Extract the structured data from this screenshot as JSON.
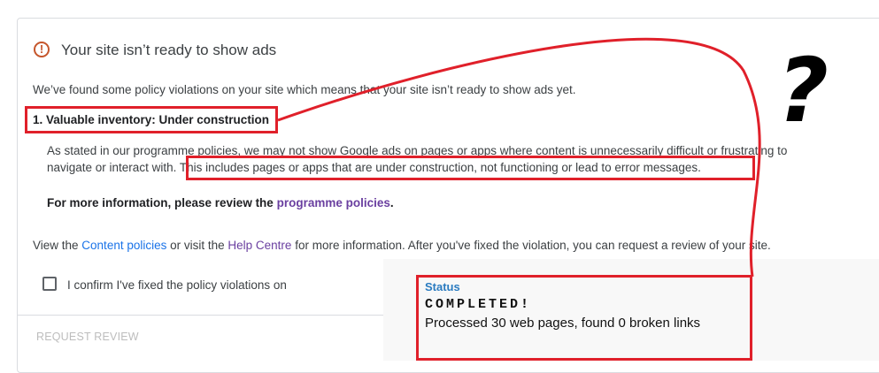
{
  "header": {
    "title": "Your site isn’t ready to show ads",
    "warning_icon": "!"
  },
  "intro": "We’ve found some policy violations on your site which means that your site isn’t ready to show ads yet.",
  "violation": {
    "heading": "1. Valuable inventory: Under construction",
    "body_line1": "As stated in our programme policies, we may not show Google ads on pages or apps where content is unnecessarily difficult or frustrating to",
    "body_line2a": "navigate or interact with.",
    "body_line2b": "This includes pages or apps that are under construction, not functioning or lead to error messages.",
    "more_info_prefix": "For more information, please review the ",
    "more_info_link": "programme policies",
    "more_info_suffix": "."
  },
  "footer_text": {
    "prefix": "View the ",
    "content_link": "Content policies",
    "middle": " or visit the ",
    "help_link": "Help Centre",
    "suffix": " for more information. After you've fixed the violation, you can request a review of your site."
  },
  "confirm_checkbox_label": "I confirm I've fixed the policy violations on",
  "request_review_label": "REQUEST REVIEW",
  "status": {
    "label": "Status",
    "headline": "COMPLETED!",
    "message": "Processed 30 web pages, found 0 broken links"
  },
  "annotation": {
    "question_mark": "?",
    "color": "#e0202a"
  }
}
